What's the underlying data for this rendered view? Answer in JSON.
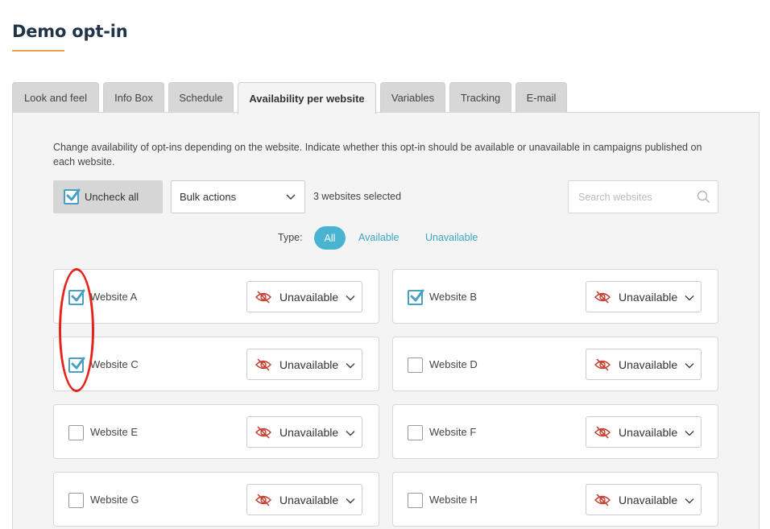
{
  "page": {
    "title": "Demo opt-in"
  },
  "tabs": [
    {
      "label": "Look and feel",
      "active": false
    },
    {
      "label": "Info Box",
      "active": false
    },
    {
      "label": "Schedule",
      "active": false
    },
    {
      "label": "Availability per website",
      "active": true
    },
    {
      "label": "Variables",
      "active": false
    },
    {
      "label": "Tracking",
      "active": false
    },
    {
      "label": "E-mail",
      "active": false
    }
  ],
  "panel": {
    "description": "Change availability of opt-ins depending on the website. Indicate whether this opt-in should be available or unavailable in campaigns published on each website.",
    "uncheck_all_label": "Uncheck all",
    "bulk_actions": {
      "selected_value": "Bulk actions"
    },
    "selected_count_text": "3 websites selected",
    "search": {
      "placeholder": "Search websites",
      "value": ""
    },
    "type_filter": {
      "label": "Type:",
      "options": [
        {
          "label": "All",
          "active": true
        },
        {
          "label": "Available",
          "active": false
        },
        {
          "label": "Unavailable",
          "active": false
        }
      ]
    }
  },
  "websites": [
    {
      "name": "Website A",
      "checked": true,
      "availability": "Unavailable"
    },
    {
      "name": "Website B",
      "checked": true,
      "availability": "Unavailable"
    },
    {
      "name": "Website C",
      "checked": true,
      "availability": "Unavailable"
    },
    {
      "name": "Website D",
      "checked": false,
      "availability": "Unavailable"
    },
    {
      "name": "Website E",
      "checked": false,
      "availability": "Unavailable"
    },
    {
      "name": "Website F",
      "checked": false,
      "availability": "Unavailable"
    },
    {
      "name": "Website G",
      "checked": false,
      "availability": "Unavailable"
    },
    {
      "name": "Website H",
      "checked": false,
      "availability": "Unavailable"
    }
  ],
  "icons": {
    "checkbox_checked": "checkbox-checked-icon",
    "eye_slash": "eye-slash-icon",
    "chevron": "chevron-down-icon",
    "search": "search-icon"
  },
  "colors": {
    "accent": "#4bb3d2",
    "link": "#3aa6c7",
    "title": "#1f3349",
    "title_underline": "#f0a04b",
    "unavailable_icon": "#c0392b",
    "annotation": "#e5231b"
  }
}
